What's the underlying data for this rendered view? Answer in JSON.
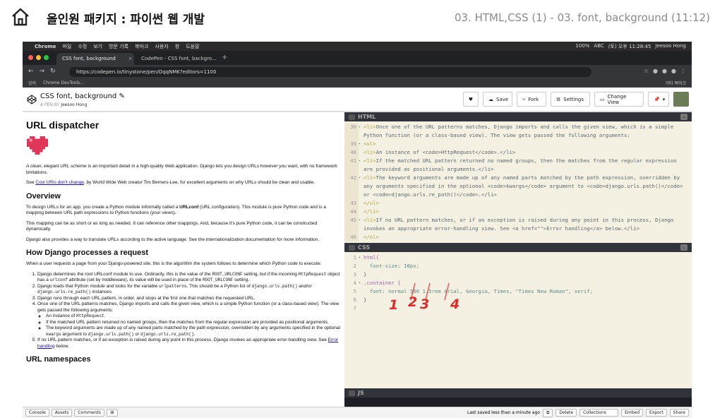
{
  "course": {
    "title": "올인원 패키지 : 파이썬 웹 개발",
    "lesson": "03. HTML,CSS (1) - 03. font, background (11:12)"
  },
  "macos": {
    "app": "Chrome",
    "menus": [
      "파일",
      "수정",
      "보기",
      "방문 기록",
      "북마크",
      "사용자",
      "창",
      "도움말"
    ],
    "status": [
      "100%",
      "ABC",
      "(토) 오후 11:28:45",
      "Jeesoo Hong"
    ]
  },
  "browser": {
    "tabs": [
      "CSS font, background",
      "CodePen - CSS font, backgro..."
    ],
    "url": "https://codepen.io/tinystone/pen/OqqNMK?editors=1100",
    "bookmarks": [
      "강의",
      "Chrome DevTools..."
    ],
    "other_bookmarks": "기타 북마크"
  },
  "codepen": {
    "pen_title": "CSS font, background",
    "author_prefix": "A PEN BY",
    "author": "Jeesoo Hong",
    "buttons": {
      "save": "Save",
      "fork": "Fork",
      "settings": "Settings",
      "change_view": "Change View"
    }
  },
  "preview": {
    "h1": "URL dispatcher",
    "intro_em": "A clean, elegant URL scheme",
    "intro_rest": " is an important detail in a high-quality Web application. Django lets you design URLs however you want, with no framework limitations.",
    "see_prefix": "See ",
    "see_link": "Cool URIs don't change",
    "see_rest": ", by World Wide Web creator Tim Berners-Lee, for excellent arguments on why URLs should be clean and usable.",
    "h2_overview": "Overview",
    "overview_p1a": "To design URLs for an app, you create a Python module informally called a ",
    "overview_p1b": "URLconf",
    "overview_p1c": " (URL configuration). This module is pure Python code and is a mapping between URL path expressions to Python functions (your views).",
    "overview_p2": "This mapping can be as short or as long as needed. It can reference other mappings. And, because it's pure Python code, it can be constructed dynamically.",
    "overview_p3": "Django also provides a way to translate URLs according to the active language. See the internationalization documentation for more information.",
    "h2_how": "How Django processes a request",
    "how_p": "When a user requests a page from your Django-powered site, this is the algorithm the system follows to determine which Python code to execute:",
    "steps": {
      "s1a": "Django determines the root URLconf module to use. Ordinarily, this is the value of the ",
      "s1b": "ROOT_URLCONF",
      "s1c": " setting, but if the incoming ",
      "s1d": "HttpRequest",
      "s1e": " object has a ",
      "s1f": "urlconf",
      "s1g": " attribute (set by middleware), its value will be used in place of the ",
      "s1h": "ROOT_URLCONF",
      "s1i": " setting.",
      "s2a": "Django loads that Python module and looks for the variable ",
      "s2b": "urlpatterns",
      "s2c": ". This should be a Python list of ",
      "s2d": "django.urls.path()",
      "s2e": " and/or ",
      "s2f": "django.urls.re_path()",
      "s2g": " instances.",
      "s3": "Django runs through each URL pattern, in order, and stops at the first one that matches the requested URL.",
      "s4": "Once one of the URL patterns matches, Django imports and calls the given view, which is a simple Python function (or a class-based view). The view gets passed the following arguments:",
      "s4_sub1a": "An instance of ",
      "s4_sub1b": "HttpRequest",
      "s4_sub1c": ".",
      "s4_sub2": "If the matched URL pattern returned no named groups, then the matches from the regular expression are provided as positional arguments.",
      "s4_sub3a": "The keyword arguments are made up of any named parts matched by the path expression, overridden by any arguments specified in the optional ",
      "s4_sub3b": "kwargs",
      "s4_sub3c": " argument to ",
      "s4_sub3d": "django.urls.path()",
      "s4_sub3e": " or ",
      "s4_sub3f": "django.urls.re_path()",
      "s4_sub3g": ".",
      "s5a": "If no URL pattern matches, or if an exception is raised during any point in this process, Django invokes an appropriate error-handling view. See ",
      "s5b": "Error handling",
      "s5c": " below."
    },
    "h2_ns": "URL namespaces"
  },
  "html_editor": {
    "label": "HTML",
    "lines": [
      {
        "n": "38",
        "fold": "▾",
        "t1": "    <li>",
        "t2": "Once one of the URL patterns matches, Django imports and calls the given view, which is a simple Python function (or a class-based view). The view gets passed the following arguments:"
      },
      {
        "n": "39",
        "fold": "▾",
        "t1": "      <ul>",
        "t2": ""
      },
      {
        "n": "40",
        "fold": "",
        "t1": "        <li>",
        "t2": "An instance of <code>HttpRequest</code>.</li>"
      },
      {
        "n": "41",
        "fold": "▾",
        "t1": "        <li>",
        "t2": "If the matched URL pattern returned no named groups, then the matches from the regular expression are provided as positional arguments.</li>"
      },
      {
        "n": "42",
        "fold": "▾",
        "t1": "        <li>",
        "t2": "The keyword arguments are made up of any named parts matched by the path expression, overridden by any arguments specified in the optional <code>kwargs</code> argument to <code>django.urls.path()</code> or <code>django.urls.re_path()</code>.</li>"
      },
      {
        "n": "43",
        "fold": "",
        "t1": "      </ul>",
        "t2": ""
      },
      {
        "n": "44",
        "fold": "",
        "t1": "    </li>",
        "t2": ""
      },
      {
        "n": "45",
        "fold": "▾",
        "t1": "    <li>",
        "t2": "If no URL pattern matches, or if an exception is raised during any point in this process, Django invokes an appropriate error-handling view. See <a href=\"\">Error handling</a> below.</li>"
      },
      {
        "n": "46",
        "fold": "",
        "t1": "  </ol>",
        "t2": ""
      }
    ]
  },
  "css_editor": {
    "label": "CSS",
    "lines": [
      {
        "n": "1",
        "fold": "▾",
        "t": "html{"
      },
      {
        "n": "2",
        "fold": "",
        "t": "  font-size: 10px;"
      },
      {
        "n": "3",
        "fold": "",
        "t": "}"
      },
      {
        "n": "4",
        "fold": "▾",
        "t": ".container {"
      },
      {
        "n": "5",
        "fold": "",
        "t": "  font: normal 500 1.5rem Arial, Georgia, Times, \"Times New Roman\", serif;"
      },
      {
        "n": "6",
        "fold": "",
        "t": "}"
      },
      {
        "n": "7",
        "fold": "",
        "t": ""
      }
    ],
    "annotation_marks": [
      "1",
      "2",
      "3",
      "4"
    ]
  },
  "js_editor": {
    "label": "JS"
  },
  "footer": {
    "left": [
      "Console",
      "Assets",
      "Comments",
      "⌘"
    ],
    "saved": "Last saved less than a minute ago",
    "right": [
      "Delete",
      "Collections",
      "Embed",
      "Export",
      "Share"
    ]
  },
  "colors": {
    "annotation": "#e0292a",
    "editor_bg": "#f5f1e2"
  }
}
